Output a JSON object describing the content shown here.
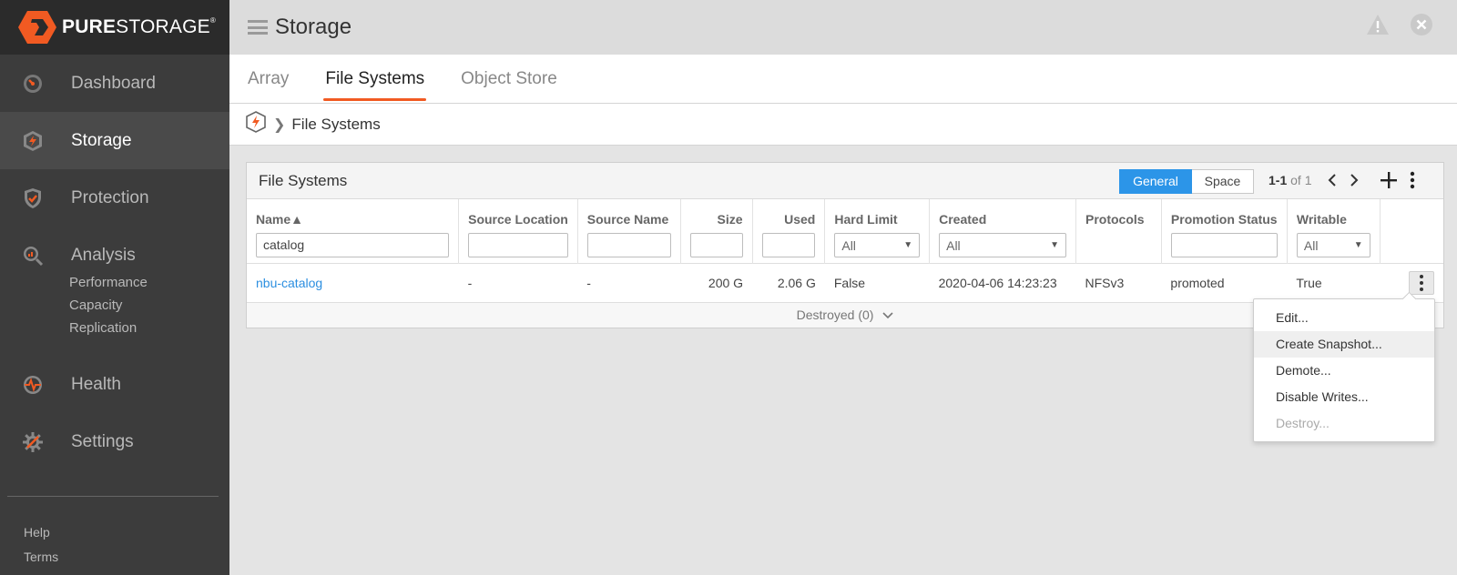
{
  "brand": {
    "bold": "PURE",
    "light": "STORAGE",
    "reg": "®",
    "accent": "#f15a22"
  },
  "nav": {
    "items": [
      {
        "key": "dashboard",
        "label": "Dashboard",
        "icon": "dashboard-gauge-icon"
      },
      {
        "key": "storage",
        "label": "Storage",
        "icon": "storage-bolt-icon",
        "active": true
      },
      {
        "key": "protection",
        "label": "Protection",
        "icon": "shield-check-icon"
      },
      {
        "key": "analysis",
        "label": "Analysis",
        "icon": "analysis-magnifier-icon"
      }
    ],
    "analysis_sub": [
      "Performance",
      "Capacity",
      "Replication"
    ],
    "items2": [
      {
        "key": "health",
        "label": "Health",
        "icon": "health-pulse-icon"
      },
      {
        "key": "settings",
        "label": "Settings",
        "icon": "settings-gear-icon"
      }
    ],
    "footer": [
      "Help",
      "Terms"
    ]
  },
  "header": {
    "title": "Storage"
  },
  "tabs": [
    "Array",
    "File Systems",
    "Object Store"
  ],
  "breadcrumb": {
    "current": "File Systems"
  },
  "panel": {
    "title": "File Systems",
    "views": [
      "General",
      "Space"
    ],
    "pager": {
      "range": "1-1",
      "of": "of 1"
    }
  },
  "table": {
    "columns": {
      "name": "Name▲",
      "source_location": "Source Location",
      "source_name": "Source Name",
      "size": "Size",
      "used": "Used",
      "hard_limit": "Hard Limit",
      "created": "Created",
      "protocols": "Protocols",
      "promotion_status": "Promotion Status",
      "writable": "Writable"
    },
    "filters": {
      "name": "catalog",
      "hard_limit": "All",
      "created": "All",
      "writable": "All"
    },
    "rows": [
      {
        "name": "nbu-catalog",
        "source_location": "-",
        "source_name": "-",
        "size": "200 G",
        "used": "2.06 G",
        "hard_limit": "False",
        "created": "2020-04-06 14:23:23",
        "protocols": "NFSv3",
        "promotion_status": "promoted",
        "writable": "True"
      }
    ],
    "destroyed": "Destroyed (0)"
  },
  "menu": [
    "Edit...",
    "Create Snapshot...",
    "Demote...",
    "Disable Writes...",
    "Destroy..."
  ]
}
